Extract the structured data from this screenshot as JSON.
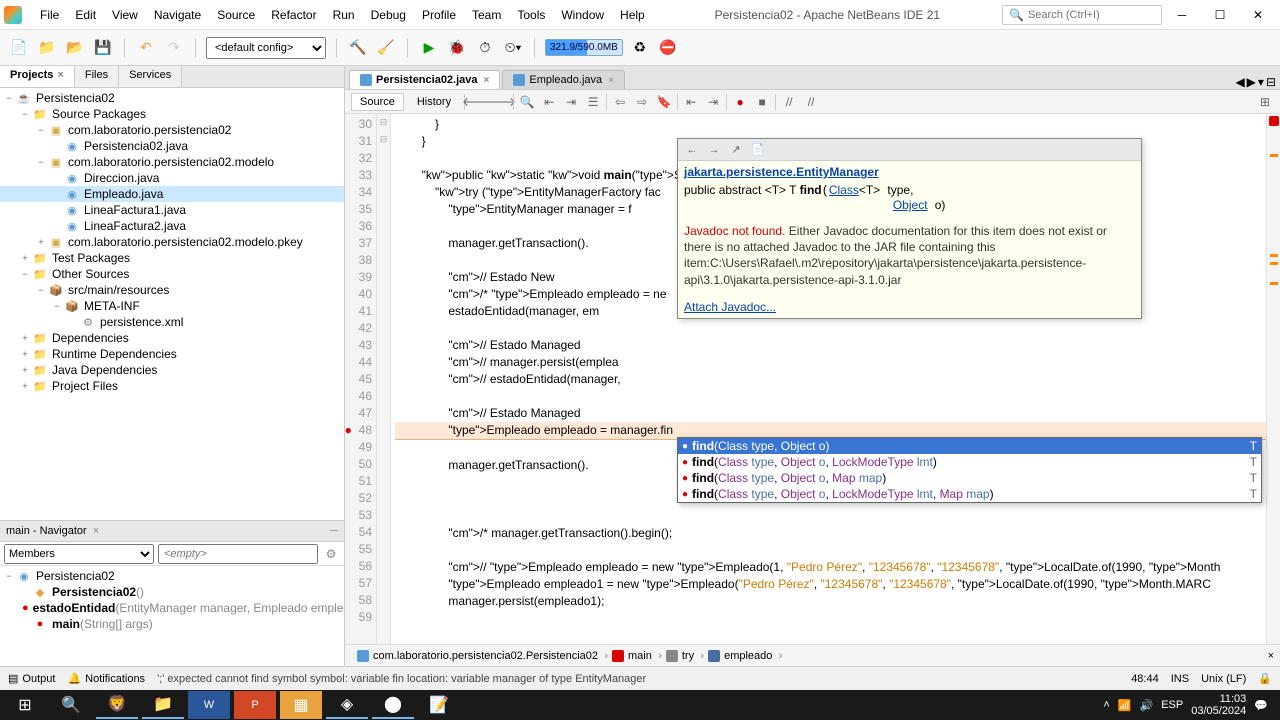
{
  "window": {
    "title": "Persistencia02 - Apache NetBeans IDE 21",
    "search_placeholder": "Search (Ctrl+I)"
  },
  "menubar": [
    "File",
    "Edit",
    "View",
    "Navigate",
    "Source",
    "Refactor",
    "Run",
    "Debug",
    "Profile",
    "Team",
    "Tools",
    "Window",
    "Help"
  ],
  "toolbar": {
    "config_select": "<default config>",
    "memory": "321.9/590.0MB"
  },
  "project_tabs": {
    "tabs": [
      "Projects",
      "Files",
      "Services"
    ],
    "active": 0
  },
  "project_tree": [
    {
      "d": 0,
      "i": "coffee",
      "t": "Persistencia02",
      "x": "−"
    },
    {
      "d": 1,
      "i": "folder",
      "t": "Source Packages",
      "x": "−"
    },
    {
      "d": 2,
      "i": "pkg",
      "t": "com.laboratorio.persistencia02",
      "x": "−"
    },
    {
      "d": 3,
      "i": "cls",
      "t": "Persistencia02.java"
    },
    {
      "d": 2,
      "i": "pkg",
      "t": "com.laboratorio.persistencia02.modelo",
      "x": "−"
    },
    {
      "d": 3,
      "i": "cls",
      "t": "Direccion.java"
    },
    {
      "d": 3,
      "i": "cls",
      "t": "Empleado.java",
      "sel": true
    },
    {
      "d": 3,
      "i": "cls",
      "t": "LineaFactura1.java"
    },
    {
      "d": 3,
      "i": "cls",
      "t": "LineaFactura2.java"
    },
    {
      "d": 2,
      "i": "pkg",
      "t": "com.laboratorio.persistencia02.modelo.pkey",
      "x": "+"
    },
    {
      "d": 1,
      "i": "folder",
      "t": "Test Packages",
      "x": "+"
    },
    {
      "d": 1,
      "i": "folder",
      "t": "Other Sources",
      "x": "−"
    },
    {
      "d": 2,
      "i": "rsc",
      "t": "src/main/resources",
      "x": "−"
    },
    {
      "d": 3,
      "i": "rsc",
      "t": "META-INF",
      "x": "−"
    },
    {
      "d": 4,
      "i": "xml",
      "t": "persistence.xml"
    },
    {
      "d": 1,
      "i": "folder",
      "t": "Dependencies",
      "x": "+"
    },
    {
      "d": 1,
      "i": "folder",
      "t": "Runtime Dependencies",
      "x": "+"
    },
    {
      "d": 1,
      "i": "folder",
      "t": "Java Dependencies",
      "x": "+"
    },
    {
      "d": 1,
      "i": "folder",
      "t": "Project Files",
      "x": "+"
    }
  ],
  "navigator": {
    "title": "main - Navigator",
    "view": "Members",
    "filter_placeholder": "<empty>",
    "items": [
      {
        "i": "cls",
        "t": "Persistencia02",
        "x": "−"
      },
      {
        "i": "ctor",
        "t": "Persistencia02()"
      },
      {
        "i": "meth",
        "t": "estadoEntidad(EntityManager manager, Empleado emplea"
      },
      {
        "i": "meth",
        "t": "main(String[] args)"
      }
    ]
  },
  "editor_tabs": [
    {
      "name": "Persistencia02.java",
      "active": true
    },
    {
      "name": "Empleado.java",
      "active": false
    }
  ],
  "editor_modes": {
    "source": "Source",
    "history": "History"
  },
  "code": {
    "first_line": 30,
    "lines": [
      "            }",
      "        }",
      "",
      "        public static void main(String[] ",
      "            try (EntityManagerFactory fac                                                                  unit\")) {",
      "                EntityManager manager = f",
      "",
      "                manager.getTransaction().",
      "",
      "                // Estado New",
      "                /* Empleado empleado = ne                                                                   1990, Month.MA",
      "                estadoEntidad(manager, em",
      "",
      "                // Estado Managed",
      "                // manager.persist(emplea",
      "                // estadoEntidad(manager,",
      "",
      "                // Estado Managed",
      "                Empleado empleado = manager.fin",
      "",
      "                manager.getTransaction().",
      "",
      "",
      "",
      "                /* manager.getTransaction().begin();",
      "",
      "                // Empleado empleado = new Empleado(1, \"Pedro Pérez\", \"12345678\", \"12345678\", LocalDate.of(1990, Month",
      "                Empleado empleado1 = new Empleado(\"Pedro Pérez\", \"12345678\", \"12345678\", LocalDate.of(1990, Month.MARC",
      "                manager.persist(empleado1);",
      ""
    ],
    "error_line_index": 18
  },
  "javadoc": {
    "class_link": "jakarta.persistence.EntityManager",
    "sig_prefix": "public abstract <T> T ",
    "sig_method": "find",
    "sig_p1_type": "Class",
    "sig_p1_gen": "<T>",
    "sig_p1_name": "type,",
    "sig_p2_type": "Object",
    "sig_p2_name": "o)",
    "not_found": "Javadoc not found.",
    "text": " Either Javadoc documentation for this item does not exist or there is no attached Javadoc to the JAR file containing this item:C:\\Users\\Rafael\\.m2\\repository\\jakarta\\persistence\\jakarta.persistence-api\\3.1.0\\jakarta.persistence-api-3.1.0.jar",
    "attach": "Attach Javadoc..."
  },
  "completion": [
    {
      "sel": true,
      "m": "find",
      "sig": "(Class<T> type, Object o)",
      "ret": "T"
    },
    {
      "sel": false,
      "m": "find",
      "sig": "(Class<T> type, Object o, LockModeType lmt)",
      "ret": "T"
    },
    {
      "sel": false,
      "m": "find",
      "sig": "(Class<T> type, Object o, Map<String, Object> map)",
      "ret": "T"
    },
    {
      "sel": false,
      "m": "find",
      "sig": "(Class<T> type, Object o, LockModeType lmt, Map<String, Object> map)",
      "ret": "T"
    }
  ],
  "breadcrumb": [
    {
      "i": "cls",
      "t": "com.laboratorio.persistencia02.Persistencia02"
    },
    {
      "i": "meth",
      "t": "main"
    },
    {
      "i": "kw",
      "t": "try"
    },
    {
      "i": "var",
      "t": "empleado"
    }
  ],
  "statusbar": {
    "output": "Output",
    "notifications": "Notifications",
    "error": "';' expected  cannot find symbol   symbol:   variable fin   location: variable manager of type EntityManager",
    "pos": "48:44",
    "ins": "INS",
    "enc": "Unix (LF)"
  },
  "taskbar": {
    "time": "11:03",
    "date": "03/05/2024"
  }
}
